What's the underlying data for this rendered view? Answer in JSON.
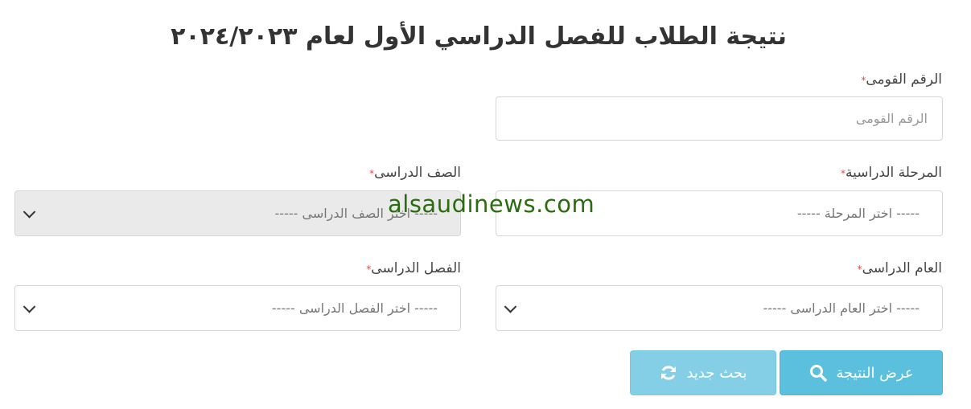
{
  "page": {
    "title": "نتيجة الطلاب للفصل الدراسي الأول لعام ٢٠٢٤/٢٠٢٣"
  },
  "form": {
    "required_marker": "*",
    "national_id": {
      "label": "الرقم القومى",
      "placeholder": "الرقم القومى"
    },
    "stage": {
      "label": "المرحلة الدراسية",
      "selected": "----- اختر المرحلة -----"
    },
    "grade": {
      "label": "الصف الدراسى",
      "selected": "----- اختر الصف الدراسى -----"
    },
    "year": {
      "label": "العام الدراسى",
      "selected": "----- اختر العام الدراسى -----"
    },
    "term": {
      "label": "الفصل الدراسى",
      "selected": "----- اختر الفصل الدراسى -----"
    }
  },
  "buttons": {
    "show_result": "عرض النتيجة",
    "new_search": "بحث جديد"
  },
  "watermark": "alsaudinews.com",
  "colors": {
    "button_bg": "#5bc0de",
    "required_marker": "#e04848",
    "watermark": "#2a6d0f"
  }
}
